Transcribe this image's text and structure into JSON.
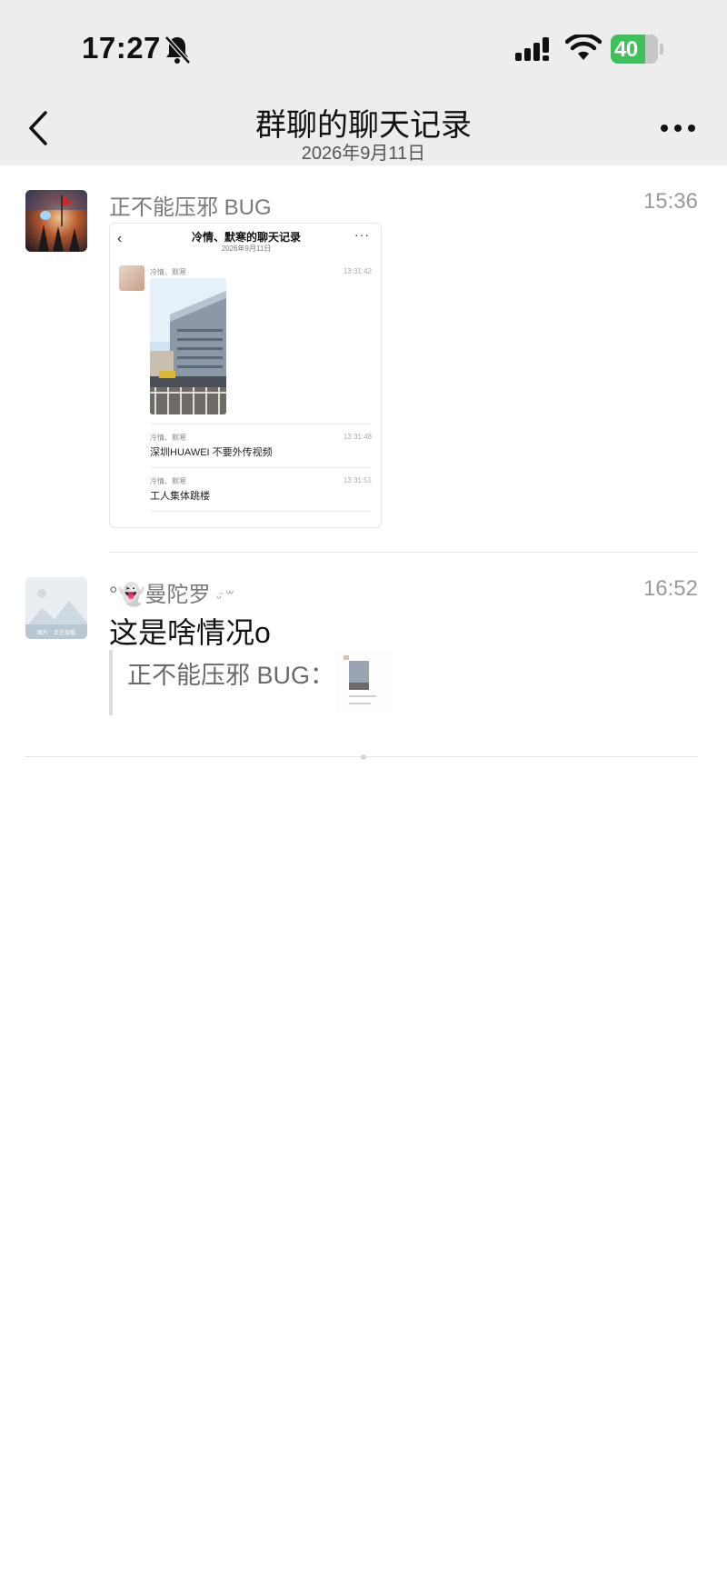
{
  "status_bar": {
    "time": "17:27",
    "battery": "40",
    "icons": [
      "bell-slash-icon",
      "signal-icon",
      "wifi-icon",
      "battery-charging-icon"
    ]
  },
  "header": {
    "title": "群聊的聊天记录",
    "subtitle": "2026年9月11日",
    "back_icon": "chevron-left-icon",
    "more_icon": "more-dots-icon"
  },
  "messages": [
    {
      "sender": "正不能压邪 BUG",
      "time": "15:36",
      "content_type": "image",
      "image": {
        "title": "冷情、默寒的聊天记录",
        "subtitle": "2026年9月11日",
        "entries": [
          {
            "sender": "冷情、默寒",
            "time": "13:31:42",
            "text": ""
          },
          {
            "sender": "冷情、默寒",
            "time": "13:31:48",
            "text": "深圳HUAWEI 不要外传视频"
          },
          {
            "sender": "冷情、默寒",
            "time": "13:31:51",
            "text": "工人集体跳楼"
          }
        ]
      }
    },
    {
      "sender": "°👻曼陀罗",
      "sender_suffix": "ᵕ̈ ꒳",
      "time": "16:52",
      "content_type": "text",
      "text": "这是啥情况o",
      "quote": {
        "sender": "正不能压邪 BUG：",
        "has_thumbnail": true
      }
    }
  ],
  "colors": {
    "header_bg": "#ededed",
    "page_bg": "#ffffff",
    "battery_green": "#3ec15a",
    "secondary_text": "#7a7a7a"
  }
}
